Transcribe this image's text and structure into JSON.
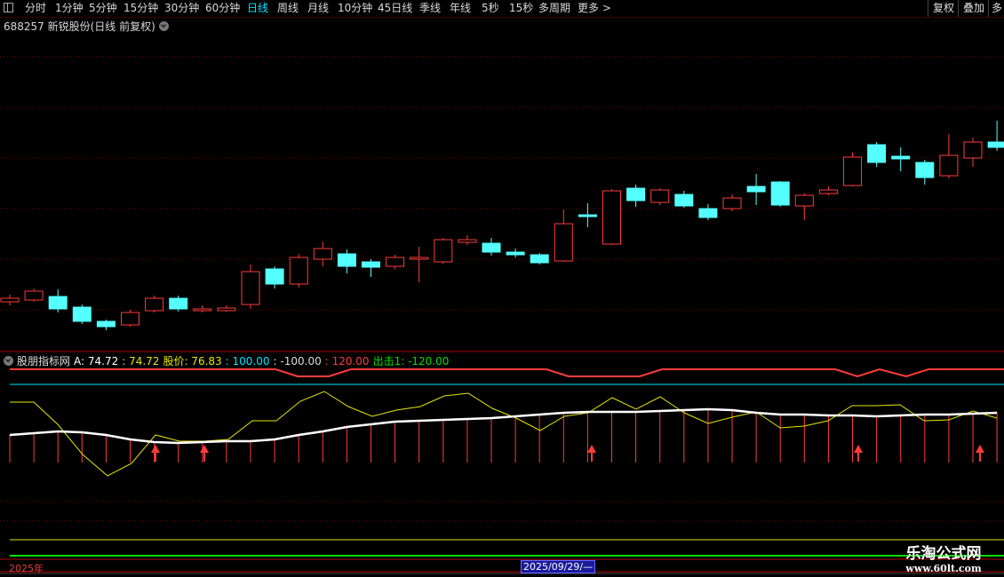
{
  "toolbar": {
    "tabs": [
      "分时",
      "1分钟",
      "5分钟",
      "15分钟",
      "30分钟",
      "60分钟",
      "日线",
      "周线",
      "月线",
      "10分钟",
      "45日线",
      "季线",
      "年线",
      "5秒",
      "15秒",
      "多周期",
      "更多 >"
    ],
    "active_tab": "日线",
    "restore_label": "复权",
    "overlay_label": "叠加",
    "more_label": "多"
  },
  "stock": {
    "title": "688257 新锐股份(日线 前复权)"
  },
  "indicator": {
    "name": "股朋指标网",
    "a_label": "A: 74.72",
    "a2": ": 74.72",
    "price_label": "股价: 76.83",
    "v100": ": 100.00",
    "vneg100": ": -100.00",
    "v120": ": 120.00",
    "exit_label": "出击1: -120.00"
  },
  "footer": {
    "year": "2025年",
    "cursor_date": "2025/09/29/—"
  },
  "watermark": {
    "line1": "乐淘公式网",
    "line2": "www.60lt.com"
  },
  "colors": {
    "up": "#ff3b3b",
    "down": "#54ffff",
    "grid": "#7a0000",
    "yellow": "#e6e600",
    "cyan": "#00e5ff",
    "green": "#00e000",
    "white": "#ffffff"
  },
  "chart_data": {
    "type": "candlestick",
    "candles": [
      {
        "o": 340,
        "c": 336,
        "h": 332,
        "l": 344,
        "up": true
      },
      {
        "o": 338,
        "c": 328,
        "h": 325,
        "l": 340,
        "up": true
      },
      {
        "o": 334,
        "c": 348,
        "h": 326,
        "l": 352,
        "up": false
      },
      {
        "o": 346,
        "c": 362,
        "h": 343,
        "l": 365,
        "up": false
      },
      {
        "o": 362,
        "c": 368,
        "h": 360,
        "l": 372,
        "up": false
      },
      {
        "o": 366,
        "c": 352,
        "h": 349,
        "l": 368,
        "up": true
      },
      {
        "o": 350,
        "c": 336,
        "h": 333,
        "l": 352,
        "up": true
      },
      {
        "o": 336,
        "c": 348,
        "h": 333,
        "l": 351,
        "up": false
      },
      {
        "o": 350,
        "c": 348,
        "h": 344,
        "l": 352,
        "up": true
      },
      {
        "o": 350,
        "c": 347,
        "h": 344,
        "l": 351,
        "up": true
      },
      {
        "o": 343,
        "c": 306,
        "h": 298,
        "l": 348,
        "up": true
      },
      {
        "o": 303,
        "c": 320,
        "h": 300,
        "l": 325,
        "up": false
      },
      {
        "o": 320,
        "c": 290,
        "h": 286,
        "l": 324,
        "up": true
      },
      {
        "o": 292,
        "c": 280,
        "h": 272,
        "l": 300,
        "up": true
      },
      {
        "o": 286,
        "c": 300,
        "h": 281,
        "l": 308,
        "up": false
      },
      {
        "o": 295,
        "c": 301,
        "h": 292,
        "l": 312,
        "up": false
      },
      {
        "o": 300,
        "c": 290,
        "h": 287,
        "l": 303,
        "up": true
      },
      {
        "o": 292,
        "c": 290,
        "h": 278,
        "l": 318,
        "up": true
      },
      {
        "o": 295,
        "c": 270,
        "h": 268,
        "l": 297,
        "up": true
      },
      {
        "o": 273,
        "c": 270,
        "h": 265,
        "l": 276,
        "up": true
      },
      {
        "o": 274,
        "c": 284,
        "h": 268,
        "l": 288,
        "up": false
      },
      {
        "o": 284,
        "c": 287,
        "h": 280,
        "l": 290,
        "up": false
      },
      {
        "o": 287,
        "c": 296,
        "h": 285,
        "l": 298,
        "up": false
      },
      {
        "o": 294,
        "c": 252,
        "h": 236,
        "l": 295,
        "up": true
      },
      {
        "o": 242,
        "c": 243,
        "h": 229,
        "l": 256,
        "up": false
      },
      {
        "o": 275,
        "c": 215,
        "h": 213,
        "l": 276,
        "up": true
      },
      {
        "o": 212,
        "c": 226,
        "h": 208,
        "l": 233,
        "up": false
      },
      {
        "o": 228,
        "c": 214,
        "h": 212,
        "l": 231,
        "up": true
      },
      {
        "o": 219,
        "c": 232,
        "h": 215,
        "l": 234,
        "up": false
      },
      {
        "o": 235,
        "c": 245,
        "h": 230,
        "l": 248,
        "up": false
      },
      {
        "o": 235,
        "c": 223,
        "h": 219,
        "l": 238,
        "up": true
      },
      {
        "o": 210,
        "c": 216,
        "h": 196,
        "l": 231,
        "up": false
      },
      {
        "o": 205,
        "c": 231,
        "h": 204,
        "l": 233,
        "up": false
      },
      {
        "o": 232,
        "c": 220,
        "h": 218,
        "l": 248,
        "up": true
      },
      {
        "o": 218,
        "c": 214,
        "h": 210,
        "l": 220,
        "up": true
      },
      {
        "o": 209,
        "c": 177,
        "h": 172,
        "l": 210,
        "up": true
      },
      {
        "o": 163,
        "c": 183,
        "h": 160,
        "l": 188,
        "up": false
      },
      {
        "o": 176,
        "c": 179,
        "h": 166,
        "l": 193,
        "up": false
      },
      {
        "o": 183,
        "c": 200,
        "h": 180,
        "l": 208,
        "up": false
      },
      {
        "o": 198,
        "c": 175,
        "h": 151,
        "l": 201,
        "up": true
      },
      {
        "o": 178,
        "c": 160,
        "h": 155,
        "l": 188,
        "up": true
      },
      {
        "o": 160,
        "c": 166,
        "h": 136,
        "l": 170,
        "up": false
      }
    ]
  }
}
